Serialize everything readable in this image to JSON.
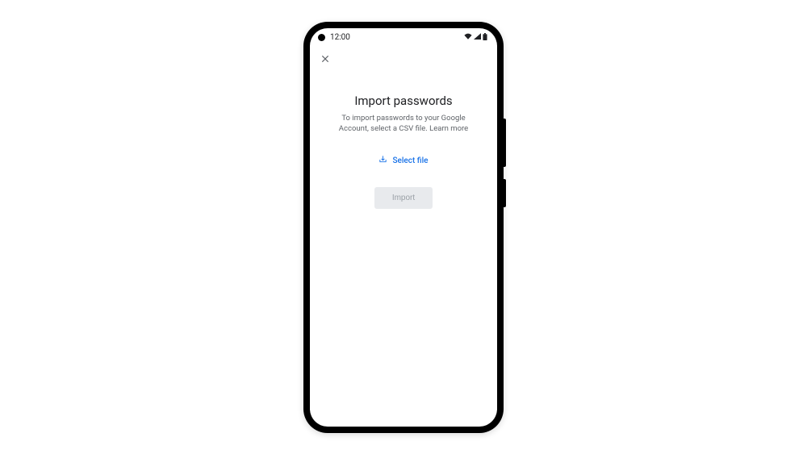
{
  "statusBar": {
    "time": "12:00"
  },
  "page": {
    "title": "Import passwords",
    "description": "To import passwords to your Google Account, select a CSV file. Learn more",
    "selectFileLabel": "Select file",
    "importLabel": "Import"
  }
}
